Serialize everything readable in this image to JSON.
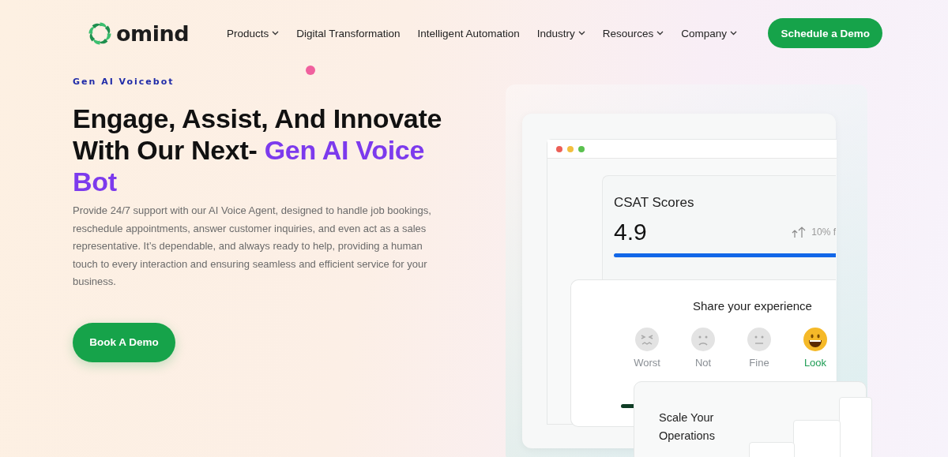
{
  "header": {
    "logo": "omind",
    "nav": [
      {
        "label": "Products",
        "dropdown": true
      },
      {
        "label": "Digital Transformation",
        "dropdown": false
      },
      {
        "label": "Intelligent Automation",
        "dropdown": false
      },
      {
        "label": "Industry",
        "dropdown": true
      },
      {
        "label": "Resources",
        "dropdown": true
      },
      {
        "label": "Company",
        "dropdown": true
      }
    ],
    "cta": "Schedule a Demo"
  },
  "hero": {
    "eyebrow": "Gen AI Voicebot",
    "heading": "Engage, Assist, And Innovate With Our Next-",
    "heading_highlight": "Gen AI Voice Bot",
    "description": "Provide 24/7 support with our AI Voice Agent, designed to handle job bookings, reschedule appointments, answer customer inquiries, and even act as a sales representative. It’s dependable, and always ready to help, providing a human touch to every interaction and ensuring seamless and efficient service for your business.",
    "button": "Book A Demo"
  },
  "illustration": {
    "csat": {
      "title": "CSAT Scores",
      "score": "4.9",
      "trend": "10% f"
    },
    "feedback": {
      "title": "Share your experience",
      "options": [
        {
          "label": "Worst",
          "kind": "worst",
          "selected": false
        },
        {
          "label": "Not",
          "kind": "sad",
          "selected": false
        },
        {
          "label": "Fine",
          "kind": "neutral",
          "selected": false
        },
        {
          "label": "Look",
          "kind": "happy",
          "selected": true
        }
      ]
    },
    "scale": {
      "title": "Scale Your Operations"
    }
  }
}
